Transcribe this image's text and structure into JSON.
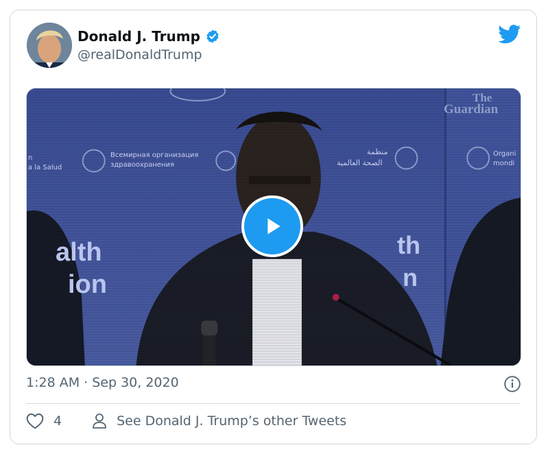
{
  "tweet": {
    "author_name": "Donald J. Trump",
    "handle": "@realDonaldTrump",
    "verified": true,
    "timestamp": "1:28 AM · Sep 30, 2020",
    "like_count": "4",
    "see_more_label": "See Donald J. Trump’s other Tweets"
  },
  "media": {
    "type": "video",
    "backdrop_text": {
      "left_large_1": "alth",
      "left_large_2": "ion",
      "right_large_1": "th",
      "right_large_2": "n",
      "left_small_1": "n",
      "left_small_2": "a la Salud",
      "russian_1": "Всемирная организация",
      "russian_2": "здравоохранения",
      "arabic_1": "منظمة",
      "arabic_2": "الصحة العالمية",
      "right_small_1": "Organi",
      "right_small_2": "mondi",
      "watermark_1": "The",
      "watermark_2": "Guardian"
    }
  },
  "icons": {
    "verified": "verified-badge-icon",
    "brand": "twitter-bird-icon",
    "play": "play-icon",
    "info": "info-icon",
    "like": "heart-icon",
    "profile": "person-icon"
  },
  "colors": {
    "accent": "#1d9bf0",
    "text_primary": "#0f1419",
    "text_secondary": "#536471",
    "border": "#cfd9de",
    "video_backdrop": "#3c4e95"
  }
}
